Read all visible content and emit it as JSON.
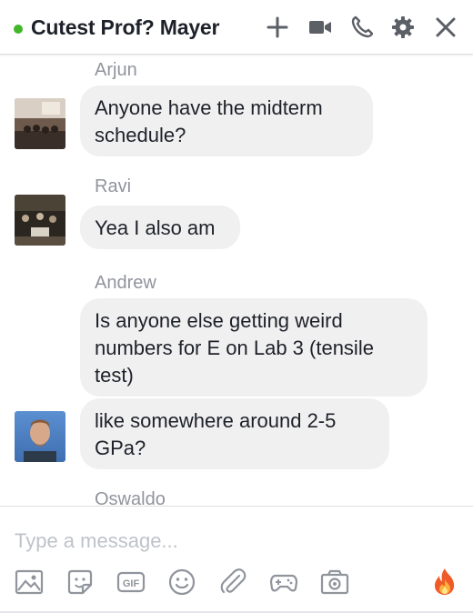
{
  "header": {
    "title": "Cutest Prof? Mayer",
    "online_color": "#42b72a",
    "buttons": [
      "plus-icon",
      "video-camera-icon",
      "phone-icon",
      "gear-icon",
      "close-icon"
    ]
  },
  "messages": [
    {
      "sender": "Arjun",
      "bubbles": [
        "Anyone have the midterm schedule?"
      ]
    },
    {
      "sender": "Ravi",
      "bubbles": [
        "Yea I also am"
      ]
    },
    {
      "sender": "Andrew",
      "bubbles": [
        "Is anyone else getting weird numbers for E on Lab 3 (tensile test)",
        "like somewhere around 2-5 GPa?"
      ]
    },
    {
      "sender": "Oswaldo",
      "bubbles": []
    }
  ],
  "composer": {
    "placeholder": "Type a message...",
    "tools": [
      "image-icon",
      "sticker-icon",
      "gif-icon",
      "emoji-icon",
      "attachment-icon",
      "game-controller-icon",
      "camera-icon",
      "fire-emoji-icon"
    ]
  },
  "colors": {
    "bubble": "#f1f0f0",
    "sender": "#90949c",
    "icon": "#90949c",
    "header_icon": "#5b5f66"
  }
}
